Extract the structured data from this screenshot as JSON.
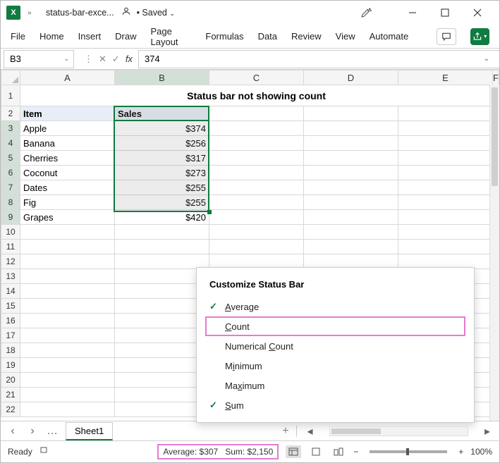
{
  "titlebar": {
    "filename": "status-bar-exce...",
    "saved": "• Saved",
    "chev": "»",
    "dropdown": "⌄"
  },
  "ribbon": {
    "tabs": [
      "File",
      "Home",
      "Insert",
      "Draw",
      "Page Layout",
      "Formulas",
      "Data",
      "Review",
      "View",
      "Automate"
    ]
  },
  "fbar": {
    "cell": "B3",
    "value": "374",
    "sep": "⋮"
  },
  "cols": [
    "A",
    "B",
    "C",
    "D",
    "E",
    "F"
  ],
  "title": "Status bar not showing count",
  "headers": {
    "a": "Item",
    "b": "Sales"
  },
  "items": [
    "Apple",
    "Banana",
    "Cherries",
    "Coconut",
    "Dates",
    "Fig",
    "Grapes"
  ],
  "sales": [
    "$374",
    "$256",
    "$317",
    "$273",
    "$255",
    "$255",
    "$420"
  ],
  "rows": [
    "1",
    "2",
    "3",
    "4",
    "5",
    "6",
    "7",
    "8",
    "9",
    "10",
    "11",
    "12",
    "13",
    "14",
    "15",
    "16",
    "17",
    "18",
    "19",
    "20",
    "21",
    "22"
  ],
  "ctx": {
    "title": "Customize Status Bar",
    "items": [
      {
        "label": "Average",
        "checked": true,
        "u": 0
      },
      {
        "label": "Count",
        "checked": false,
        "u": 0,
        "hl": true
      },
      {
        "label": "Numerical Count",
        "checked": false,
        "u": 10
      },
      {
        "label": "Minimum",
        "checked": false,
        "u": 1
      },
      {
        "label": "Maximum",
        "checked": false,
        "u": 2
      },
      {
        "label": "Sum",
        "checked": true,
        "u": 0
      }
    ]
  },
  "sheets": {
    "tab": "Sheet1",
    "prev": "‹",
    "next": "›",
    "more": "…",
    "plus": "+"
  },
  "status": {
    "ready": "Ready",
    "avg": "Average: $307",
    "sum": "Sum: $2,150",
    "zoom": "100%",
    "minus": "−",
    "plus": "+"
  }
}
